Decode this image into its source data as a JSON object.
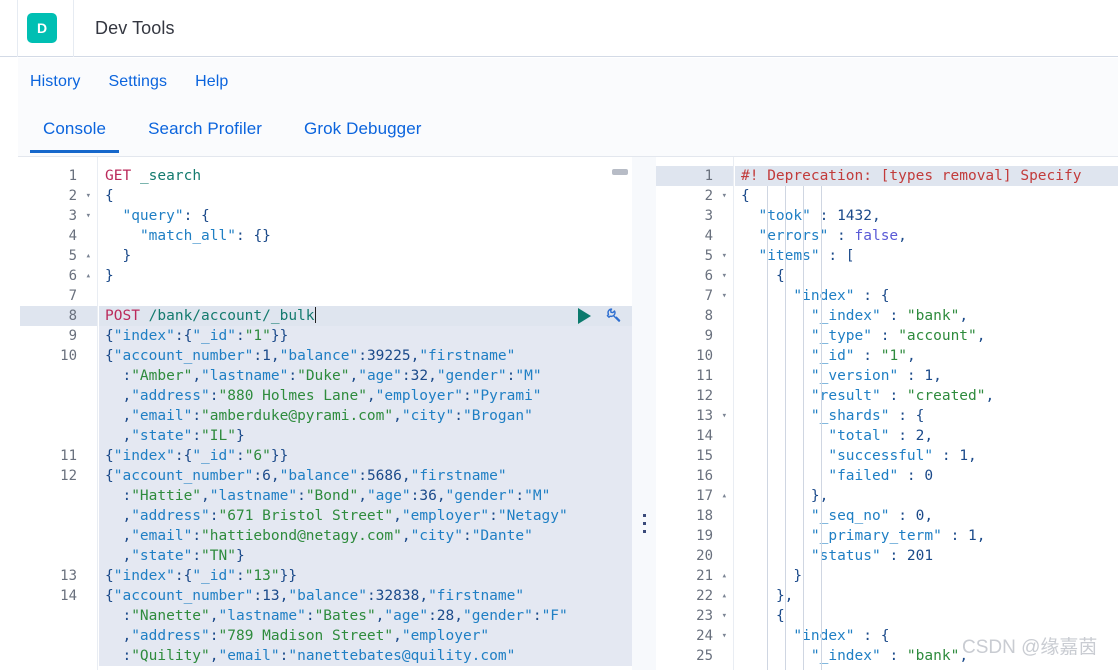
{
  "chrome": {
    "logo_letter": "D",
    "title": "Dev Tools"
  },
  "sub_nav": {
    "items": [
      {
        "label": "History"
      },
      {
        "label": "Settings"
      },
      {
        "label": "Help"
      }
    ]
  },
  "tabs": [
    {
      "label": "Console",
      "active": true
    },
    {
      "label": "Search Profiler",
      "active": false
    },
    {
      "label": "Grok Debugger",
      "active": false
    }
  ],
  "request_editor": {
    "scrollbar_visible": true,
    "active_line": 8,
    "actions": {
      "run_label": "play-triangle",
      "wrench_label": "wrench"
    },
    "lines": [
      {
        "num": "1",
        "fold": "",
        "text": "GET _search"
      },
      {
        "num": "2",
        "fold": "▾",
        "text": "{"
      },
      {
        "num": "3",
        "fold": "▾",
        "text": "  \"query\": {"
      },
      {
        "num": "4",
        "fold": "",
        "text": "    \"match_all\": {}"
      },
      {
        "num": "5",
        "fold": "▴",
        "text": "  }"
      },
      {
        "num": "6",
        "fold": "▴",
        "text": "}"
      },
      {
        "num": "7",
        "fold": "",
        "text": ""
      },
      {
        "num": "8",
        "fold": "",
        "text": "POST /bank/account/_bulk"
      },
      {
        "num": "9",
        "fold": "",
        "text": "{\"index\":{\"_id\":\"1\"}}"
      },
      {
        "num": "10",
        "fold": "",
        "text": "{\"account_number\":1,\"balance\":39225,\"firstname\""
      },
      {
        "num": "",
        "fold": "",
        "text": "  :\"Amber\",\"lastname\":\"Duke\",\"age\":32,\"gender\":\"M\""
      },
      {
        "num": "",
        "fold": "",
        "text": "  ,\"address\":\"880 Holmes Lane\",\"employer\":\"Pyrami\""
      },
      {
        "num": "",
        "fold": "",
        "text": "  ,\"email\":\"amberduke@pyrami.com\",\"city\":\"Brogan\""
      },
      {
        "num": "",
        "fold": "",
        "text": "  ,\"state\":\"IL\"}"
      },
      {
        "num": "11",
        "fold": "",
        "text": "{\"index\":{\"_id\":\"6\"}}"
      },
      {
        "num": "12",
        "fold": "",
        "text": "{\"account_number\":6,\"balance\":5686,\"firstname\""
      },
      {
        "num": "",
        "fold": "",
        "text": "  :\"Hattie\",\"lastname\":\"Bond\",\"age\":36,\"gender\":\"M\""
      },
      {
        "num": "",
        "fold": "",
        "text": "  ,\"address\":\"671 Bristol Street\",\"employer\":\"Netagy\""
      },
      {
        "num": "",
        "fold": "",
        "text": "  ,\"email\":\"hattiebond@netagy.com\",\"city\":\"Dante\""
      },
      {
        "num": "",
        "fold": "",
        "text": "  ,\"state\":\"TN\"}"
      },
      {
        "num": "13",
        "fold": "",
        "text": "{\"index\":{\"_id\":\"13\"}}"
      },
      {
        "num": "14",
        "fold": "",
        "text": "{\"account_number\":13,\"balance\":32838,\"firstname\""
      },
      {
        "num": "",
        "fold": "",
        "text": "  :\"Nanette\",\"lastname\":\"Bates\",\"age\":28,\"gender\":\"F\""
      },
      {
        "num": "",
        "fold": "",
        "text": "  ,\"address\":\"789 Madison Street\",\"employer\""
      },
      {
        "num": "",
        "fold": "",
        "text": "  :\"Quility\",\"email\":\"nanettebates@quility.com\""
      }
    ]
  },
  "response_editor": {
    "lines": [
      {
        "num": "1",
        "fold": "",
        "text": "#! Deprecation: [types removal] Specify"
      },
      {
        "num": "2",
        "fold": "▾",
        "text": "{"
      },
      {
        "num": "3",
        "fold": "",
        "text": "  \"took\" : 1432,"
      },
      {
        "num": "4",
        "fold": "",
        "text": "  \"errors\" : false,"
      },
      {
        "num": "5",
        "fold": "▾",
        "text": "  \"items\" : ["
      },
      {
        "num": "6",
        "fold": "▾",
        "text": "    {"
      },
      {
        "num": "7",
        "fold": "▾",
        "text": "      \"index\" : {"
      },
      {
        "num": "8",
        "fold": "",
        "text": "        \"_index\" : \"bank\","
      },
      {
        "num": "9",
        "fold": "",
        "text": "        \"_type\" : \"account\","
      },
      {
        "num": "10",
        "fold": "",
        "text": "        \"_id\" : \"1\","
      },
      {
        "num": "11",
        "fold": "",
        "text": "        \"_version\" : 1,"
      },
      {
        "num": "12",
        "fold": "",
        "text": "        \"result\" : \"created\","
      },
      {
        "num": "13",
        "fold": "▾",
        "text": "        \"_shards\" : {"
      },
      {
        "num": "14",
        "fold": "",
        "text": "          \"total\" : 2,"
      },
      {
        "num": "15",
        "fold": "",
        "text": "          \"successful\" : 1,"
      },
      {
        "num": "16",
        "fold": "",
        "text": "          \"failed\" : 0"
      },
      {
        "num": "17",
        "fold": "▴",
        "text": "        },"
      },
      {
        "num": "18",
        "fold": "",
        "text": "        \"_seq_no\" : 0,"
      },
      {
        "num": "19",
        "fold": "",
        "text": "        \"_primary_term\" : 1,"
      },
      {
        "num": "20",
        "fold": "",
        "text": "        \"status\" : 201"
      },
      {
        "num": "21",
        "fold": "▴",
        "text": "      }"
      },
      {
        "num": "22",
        "fold": "▴",
        "text": "    },"
      },
      {
        "num": "23",
        "fold": "▾",
        "text": "    {"
      },
      {
        "num": "24",
        "fold": "▾",
        "text": "      \"index\" : {"
      },
      {
        "num": "25",
        "fold": "",
        "text": "        \"_index\" : \"bank\","
      }
    ]
  },
  "watermark": {
    "text": "CSDN @缘嘉茵"
  },
  "colors": {
    "accent_teal": "#00bfb3",
    "link_blue": "#0b64dd",
    "tab_underline": "#1667cb",
    "run_button": "#0c7a6d",
    "method": "#bb2a5b",
    "url": "#137a6e",
    "string": "#2e8b3d",
    "key": "#1f7fc4",
    "warning": "#c23b3b",
    "selection": "#e4e8f2",
    "active_line": "#dfe5ef"
  }
}
